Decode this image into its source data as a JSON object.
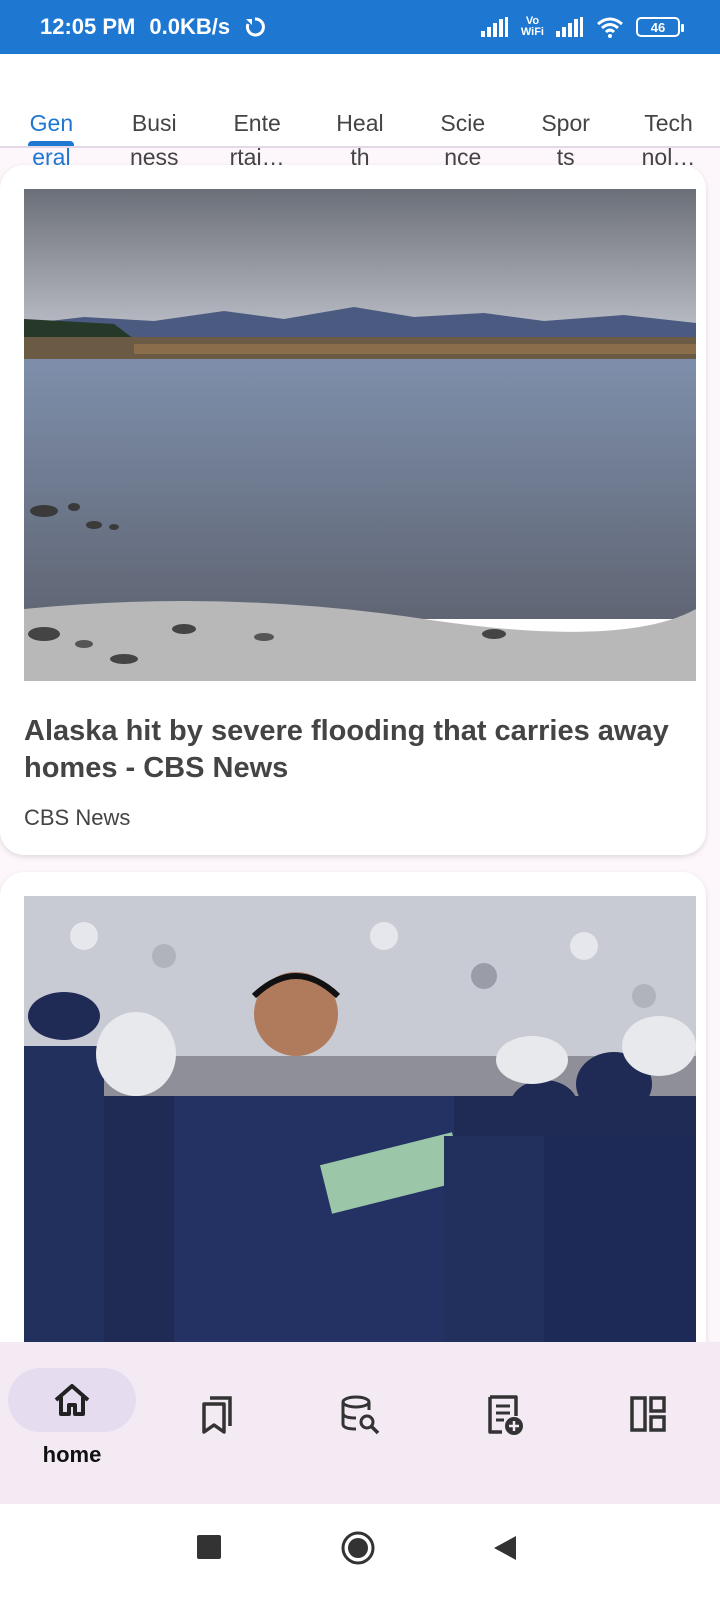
{
  "status": {
    "time": "12:05 PM",
    "speed": "0.0KB/s",
    "battery": "46",
    "volte_top": "Vo",
    "volte_bottom": "WiFi"
  },
  "tabs": [
    {
      "label": "Gen\neral",
      "active": true
    },
    {
      "label": "Busi\nness",
      "active": false
    },
    {
      "label": "Ente\nrtai…",
      "active": false
    },
    {
      "label": "Heal\nth",
      "active": false
    },
    {
      "label": "Scie\nnce",
      "active": false
    },
    {
      "label": "Spor\nts",
      "active": false
    },
    {
      "label": "Tech\nnol…",
      "active": false
    }
  ],
  "articles": [
    {
      "title": "Alaska hit by severe flooding that carries away homes - CBS News",
      "source": "CBS News"
    },
    {
      "title": "",
      "source": ""
    }
  ],
  "bottom_nav": {
    "home_label": "home",
    "items": [
      "home-icon",
      "bookmarks-icon",
      "database-search-icon",
      "add-note-icon",
      "dashboard-icon"
    ]
  },
  "colors": {
    "status_bar": "#1e78d2",
    "accent": "#1e78d2",
    "nav_background": "#f3eaf4",
    "nav_pill": "#e6dcef"
  }
}
